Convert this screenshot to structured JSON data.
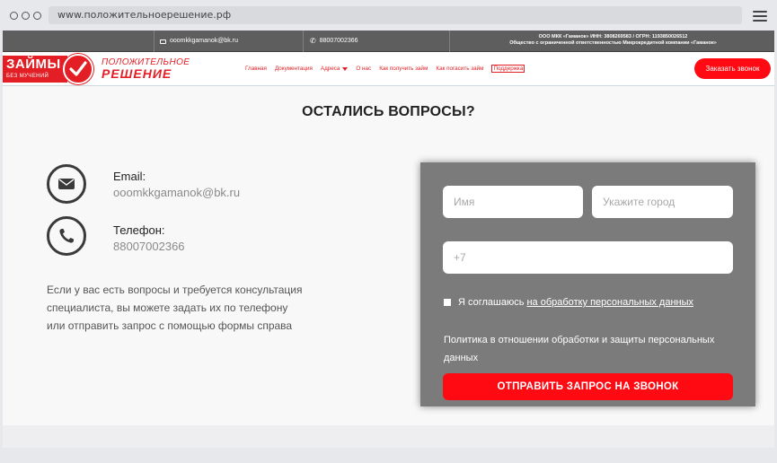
{
  "browser": {
    "url": "www.положительноерешение.рф"
  },
  "topbar": {
    "email": "ooomkkgamanok@bk.ru",
    "phone": "88007002366",
    "company_line1": "ООО МКК «Гаманок» ИНН: 3808269583 / ОГРН: 1193850026512",
    "company_line2": "Общество с ограниченной ответственностью Микрокредитной компании «Гаманок»"
  },
  "nav": {
    "logo_loans": "ЗАЙМЫ",
    "logo_loans_sub": "БЕЗ МУЧЕНИЙ",
    "logo_line1": "ПОЛОЖИТЕЛЬНОЕ",
    "logo_line2": "РЕШЕНИЕ",
    "items": [
      {
        "label": "Главная"
      },
      {
        "label": "Документация"
      },
      {
        "label": "Адреса"
      },
      {
        "label": "О нас"
      },
      {
        "label": "Как получить займ"
      },
      {
        "label": "Как погасить займ"
      },
      {
        "label": "Поддержка"
      }
    ],
    "call_button": "Заказать звонок"
  },
  "main": {
    "heading": "ОСТАЛИСЬ ВОПРОСЫ?",
    "email_label": "Email:",
    "email_value": "ooomkkgamanok@bk.ru",
    "phone_label": "Телефон:",
    "phone_value": "88007002366",
    "description_lines": [
      "Если у вас есть вопросы и требуется консультация",
      "специалиста, вы можете задать их по телефону",
      "или отправить запрос с помощью формы справа"
    ]
  },
  "form": {
    "name_placeholder": "Имя",
    "city_placeholder": "Укажите город",
    "phone_placeholder": "+7",
    "consent_text": "Я соглашаюсь",
    "consent_link": "на обработку персональных данных",
    "policy_text": "Политика в отношении обработки и защиты персональных данных",
    "submit_label": "ОТПРАВИТЬ ЗАПРОС НА ЗВОНОК"
  },
  "colors": {
    "accent": "#ff0a12",
    "brand_red": "#e31e24",
    "form_bg": "#7b7b7b",
    "topbar_bg": "#5e5e5e"
  },
  "icons": {
    "email": "envelope-icon",
    "phone": "phone-icon",
    "menu": "hamburger-icon",
    "logo": "checkmark-icon"
  }
}
